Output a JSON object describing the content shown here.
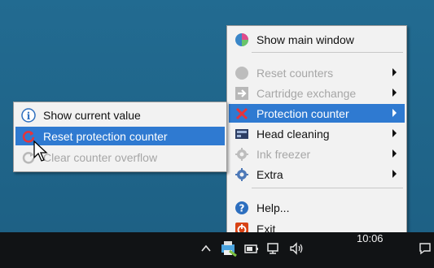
{
  "menu": {
    "items": [
      {
        "label": "Show main window",
        "icon": "show-main-window-icon",
        "enabled": true
      },
      {
        "label": "Reset counters",
        "icon": "reset-counters-icon",
        "enabled": false,
        "submenu": true
      },
      {
        "label": "Cartridge exchange",
        "icon": "cartridge-exchange-icon",
        "enabled": false,
        "submenu": true
      },
      {
        "label": "Protection counter",
        "icon": "protection-counter-icon",
        "enabled": true,
        "submenu": true,
        "highlighted": true
      },
      {
        "label": "Head cleaning",
        "icon": "head-cleaning-icon",
        "enabled": true,
        "submenu": true
      },
      {
        "label": "Ink freezer",
        "icon": "ink-freezer-icon",
        "enabled": false,
        "submenu": true
      },
      {
        "label": "Extra",
        "icon": "extra-icon",
        "enabled": true,
        "submenu": true
      },
      {
        "label": "Help...",
        "icon": "help-icon",
        "enabled": true
      },
      {
        "label": "Exit",
        "icon": "exit-icon",
        "enabled": true
      }
    ]
  },
  "submenu": {
    "items": [
      {
        "label": "Show current value",
        "icon": "info-icon",
        "enabled": true
      },
      {
        "label": "Reset protection counter",
        "icon": "reset-protection-icon",
        "enabled": true,
        "highlighted": true
      },
      {
        "label": "Clear counter overflow",
        "icon": "clear-overflow-icon",
        "enabled": false
      }
    ]
  },
  "taskbar": {
    "clock": "10:06",
    "volume_glyph": "🕪"
  },
  "colors": {
    "desktop": "#1f6488",
    "highlight": "#2f7ad1",
    "menu_bg": "#f2f2f2",
    "disabled_text": "#a6a6a6",
    "taskbar": "#111315"
  }
}
